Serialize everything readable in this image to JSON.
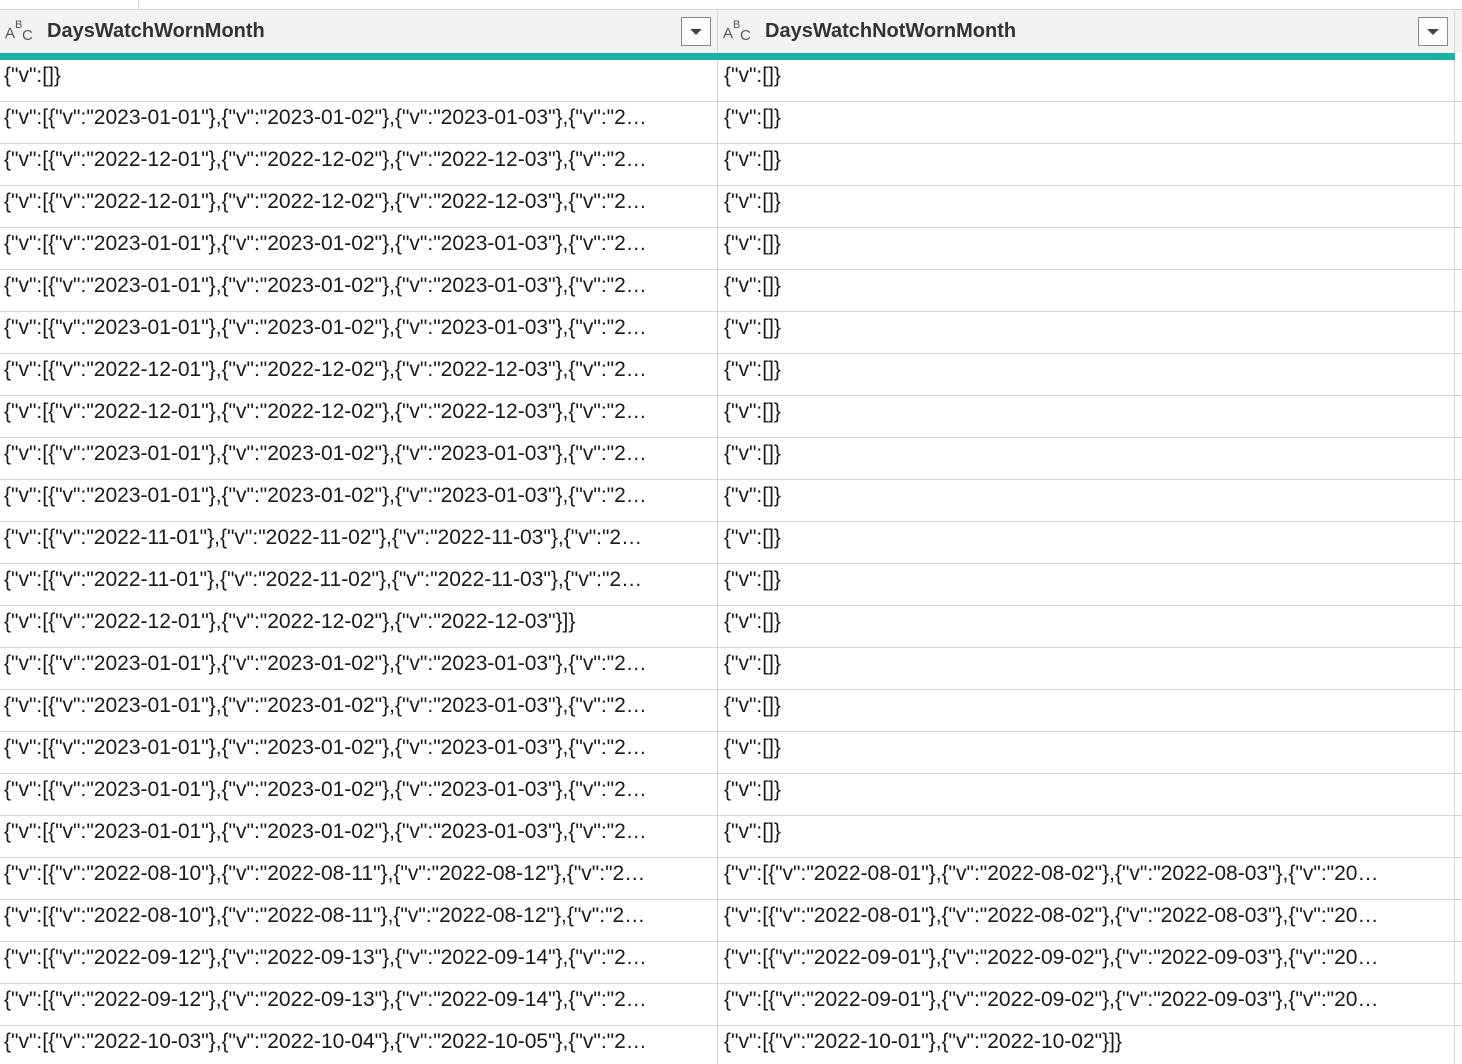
{
  "columns": [
    {
      "name": "DaysWatchWornMonth",
      "type_icon": "abc-text-type-icon"
    },
    {
      "name": "DaysWatchNotWornMonth",
      "type_icon": "abc-text-type-icon"
    }
  ],
  "type_icon_glyph": {
    "a": "A",
    "b": "B",
    "c": "C"
  },
  "quality_bar_color": "#1ab3a6",
  "rows": [
    [
      "{\"v\":[]}",
      "{\"v\":[]}"
    ],
    [
      "{\"v\":[{\"v\":\"2023-01-01\"},{\"v\":\"2023-01-02\"},{\"v\":\"2023-01-03\"},{\"v\":\"2…",
      "{\"v\":[]}"
    ],
    [
      "{\"v\":[{\"v\":\"2022-12-01\"},{\"v\":\"2022-12-02\"},{\"v\":\"2022-12-03\"},{\"v\":\"2…",
      "{\"v\":[]}"
    ],
    [
      "{\"v\":[{\"v\":\"2022-12-01\"},{\"v\":\"2022-12-02\"},{\"v\":\"2022-12-03\"},{\"v\":\"2…",
      "{\"v\":[]}"
    ],
    [
      "{\"v\":[{\"v\":\"2023-01-01\"},{\"v\":\"2023-01-02\"},{\"v\":\"2023-01-03\"},{\"v\":\"2…",
      "{\"v\":[]}"
    ],
    [
      "{\"v\":[{\"v\":\"2023-01-01\"},{\"v\":\"2023-01-02\"},{\"v\":\"2023-01-03\"},{\"v\":\"2…",
      "{\"v\":[]}"
    ],
    [
      "{\"v\":[{\"v\":\"2023-01-01\"},{\"v\":\"2023-01-02\"},{\"v\":\"2023-01-03\"},{\"v\":\"2…",
      "{\"v\":[]}"
    ],
    [
      "{\"v\":[{\"v\":\"2022-12-01\"},{\"v\":\"2022-12-02\"},{\"v\":\"2022-12-03\"},{\"v\":\"2…",
      "{\"v\":[]}"
    ],
    [
      "{\"v\":[{\"v\":\"2022-12-01\"},{\"v\":\"2022-12-02\"},{\"v\":\"2022-12-03\"},{\"v\":\"2…",
      "{\"v\":[]}"
    ],
    [
      "{\"v\":[{\"v\":\"2023-01-01\"},{\"v\":\"2023-01-02\"},{\"v\":\"2023-01-03\"},{\"v\":\"2…",
      "{\"v\":[]}"
    ],
    [
      "{\"v\":[{\"v\":\"2023-01-01\"},{\"v\":\"2023-01-02\"},{\"v\":\"2023-01-03\"},{\"v\":\"2…",
      "{\"v\":[]}"
    ],
    [
      "{\"v\":[{\"v\":\"2022-11-01\"},{\"v\":\"2022-11-02\"},{\"v\":\"2022-11-03\"},{\"v\":\"2…",
      "{\"v\":[]}"
    ],
    [
      "{\"v\":[{\"v\":\"2022-11-01\"},{\"v\":\"2022-11-02\"},{\"v\":\"2022-11-03\"},{\"v\":\"2…",
      "{\"v\":[]}"
    ],
    [
      "{\"v\":[{\"v\":\"2022-12-01\"},{\"v\":\"2022-12-02\"},{\"v\":\"2022-12-03\"}]}",
      "{\"v\":[]}"
    ],
    [
      "{\"v\":[{\"v\":\"2023-01-01\"},{\"v\":\"2023-01-02\"},{\"v\":\"2023-01-03\"},{\"v\":\"2…",
      "{\"v\":[]}"
    ],
    [
      "{\"v\":[{\"v\":\"2023-01-01\"},{\"v\":\"2023-01-02\"},{\"v\":\"2023-01-03\"},{\"v\":\"2…",
      "{\"v\":[]}"
    ],
    [
      "{\"v\":[{\"v\":\"2023-01-01\"},{\"v\":\"2023-01-02\"},{\"v\":\"2023-01-03\"},{\"v\":\"2…",
      "{\"v\":[]}"
    ],
    [
      "{\"v\":[{\"v\":\"2023-01-01\"},{\"v\":\"2023-01-02\"},{\"v\":\"2023-01-03\"},{\"v\":\"2…",
      "{\"v\":[]}"
    ],
    [
      "{\"v\":[{\"v\":\"2023-01-01\"},{\"v\":\"2023-01-02\"},{\"v\":\"2023-01-03\"},{\"v\":\"2…",
      "{\"v\":[]}"
    ],
    [
      "{\"v\":[{\"v\":\"2022-08-10\"},{\"v\":\"2022-08-11\"},{\"v\":\"2022-08-12\"},{\"v\":\"2…",
      "{\"v\":[{\"v\":\"2022-08-01\"},{\"v\":\"2022-08-02\"},{\"v\":\"2022-08-03\"},{\"v\":\"20…"
    ],
    [
      "{\"v\":[{\"v\":\"2022-08-10\"},{\"v\":\"2022-08-11\"},{\"v\":\"2022-08-12\"},{\"v\":\"2…",
      "{\"v\":[{\"v\":\"2022-08-01\"},{\"v\":\"2022-08-02\"},{\"v\":\"2022-08-03\"},{\"v\":\"20…"
    ],
    [
      "{\"v\":[{\"v\":\"2022-09-12\"},{\"v\":\"2022-09-13\"},{\"v\":\"2022-09-14\"},{\"v\":\"2…",
      "{\"v\":[{\"v\":\"2022-09-01\"},{\"v\":\"2022-09-02\"},{\"v\":\"2022-09-03\"},{\"v\":\"20…"
    ],
    [
      "{\"v\":[{\"v\":\"2022-09-12\"},{\"v\":\"2022-09-13\"},{\"v\":\"2022-09-14\"},{\"v\":\"2…",
      "{\"v\":[{\"v\":\"2022-09-01\"},{\"v\":\"2022-09-02\"},{\"v\":\"2022-09-03\"},{\"v\":\"20…"
    ],
    [
      "{\"v\":[{\"v\":\"2022-10-03\"},{\"v\":\"2022-10-04\"},{\"v\":\"2022-10-05\"},{\"v\":\"2…",
      "{\"v\":[{\"v\":\"2022-10-01\"},{\"v\":\"2022-10-02\"}]}"
    ]
  ]
}
